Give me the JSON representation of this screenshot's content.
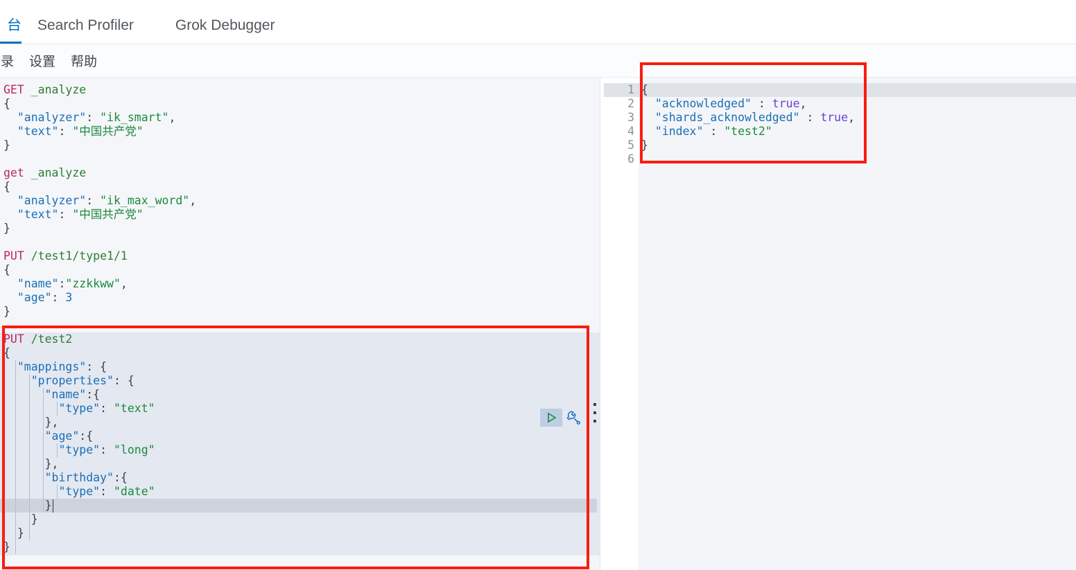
{
  "header": {
    "tabs": [
      {
        "label": "台",
        "active": true,
        "truncated": true
      },
      {
        "label": "Search Profiler",
        "active": false
      },
      {
        "label": "Grok Debugger",
        "active": false
      }
    ],
    "active_tab_underline_color": "#0071c2"
  },
  "menu": {
    "items": [
      {
        "label": "录",
        "truncated": true
      },
      {
        "label": "设置"
      },
      {
        "label": "帮助"
      }
    ]
  },
  "editor": {
    "requests": [
      {
        "id": "req-get-analyze-ik-smart",
        "method": "GET",
        "url": "_analyze",
        "body_lines": [
          "{",
          "  \"analyzer\": \"ik_smart\",",
          "  \"text\": \"中国共产党\"",
          "}"
        ]
      },
      {
        "id": "req-get-analyze-ik-max-word",
        "method": "get",
        "url": "_analyze",
        "body_lines": [
          "{",
          "  \"analyzer\": \"ik_max_word\",",
          "  \"text\": \"中国共产党\"",
          "}"
        ]
      },
      {
        "id": "req-put-test1",
        "method": "PUT",
        "url": "/test1/type1/1",
        "body_lines": [
          "{",
          "  \"name\":\"zzkkww\",",
          "  \"age\": 3",
          "}"
        ]
      },
      {
        "id": "req-put-test2",
        "method": "PUT",
        "url": "/test2",
        "active": true,
        "body_lines": [
          "{",
          "  \"mappings\": {",
          "    \"properties\": {",
          "      \"name\":{",
          "        \"type\": \"text\"",
          "      },",
          "      \"age\":{",
          "        \"type\": \"long\"",
          "      },",
          "      \"birthday\":{",
          "        \"type\": \"date\"",
          "      }",
          "    }",
          "  }",
          "}"
        ]
      }
    ],
    "actions": {
      "run_label": "▷",
      "run_title": "send-request",
      "wrench_title": "open-documentation"
    }
  },
  "response": {
    "line_numbers": [
      "1",
      "2",
      "3",
      "4",
      "5",
      "6"
    ],
    "fold_markers": {
      "1": "▾",
      "5": "▴"
    },
    "active_line": 1,
    "lines": [
      "{",
      "  \"acknowledged\" : true,",
      "  \"shards_acknowledged\" : true,",
      "  \"index\" : \"test2\"",
      "}",
      ""
    ],
    "values": {
      "acknowledged": "true",
      "shards_acknowledged": "true",
      "index": "test2"
    }
  },
  "annotations": [
    {
      "name": "response-highlight-box",
      "color": "#fb1c10"
    },
    {
      "name": "request-highlight-box",
      "color": "#fb1c10"
    }
  ]
}
